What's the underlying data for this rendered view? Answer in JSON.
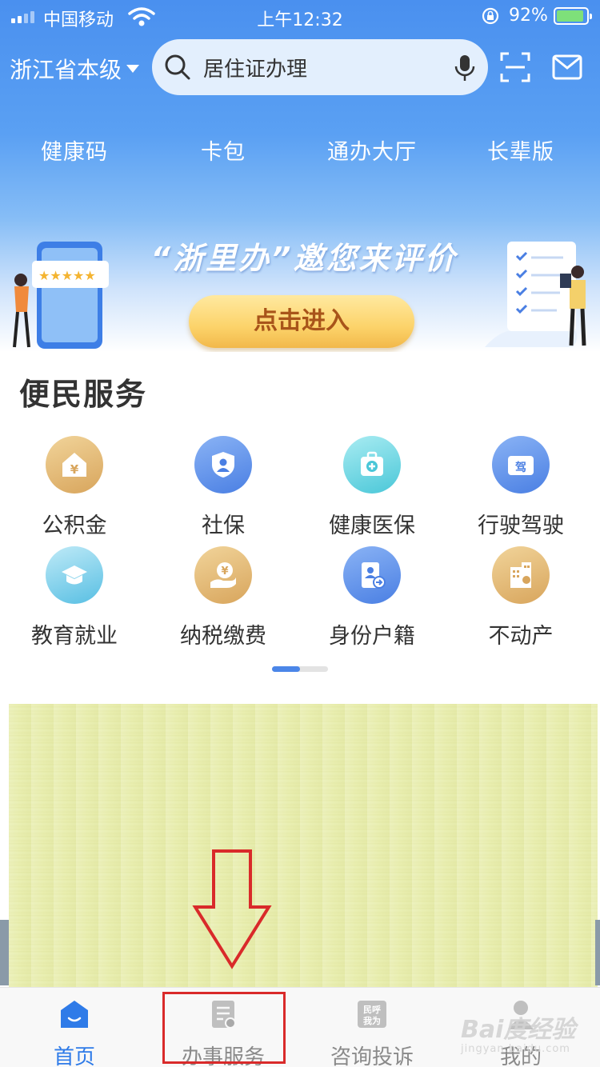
{
  "status": {
    "carrier": "中国移动",
    "time": "上午12:32",
    "battery_pct": "92%",
    "battery_level": 0.92
  },
  "header": {
    "region": "浙江省本级",
    "search_value": "居住证办理"
  },
  "quick_nav": [
    {
      "label": "健康码"
    },
    {
      "label": "卡包"
    },
    {
      "label": "通办大厅"
    },
    {
      "label": "长辈版"
    }
  ],
  "banner": {
    "title": "“浙里办”邀您来评价",
    "cta": "点击进入"
  },
  "services": {
    "title": "便民服务",
    "items": [
      {
        "label": "公积金",
        "icon": "house-yen-icon",
        "color": "#d8a55c"
      },
      {
        "label": "社保",
        "icon": "shield-user-icon",
        "color": "#4a7fe3"
      },
      {
        "label": "健康医保",
        "icon": "medical-kit-icon",
        "color": "#4ac7d8"
      },
      {
        "label": "行驶驾驶",
        "icon": "driver-card-icon",
        "color": "#4a7fe3"
      },
      {
        "label": "教育就业",
        "icon": "graduation-cap-icon",
        "color": "#58bfe3"
      },
      {
        "label": "纳税缴费",
        "icon": "tax-hand-yen-icon",
        "color": "#d8a55c"
      },
      {
        "label": "身份户籍",
        "icon": "id-badge-icon",
        "color": "#4a7fe3"
      },
      {
        "label": "不动产",
        "icon": "building-icon",
        "color": "#d8a55c"
      }
    ],
    "page_index": 1,
    "page_count": 2
  },
  "tabs": [
    {
      "label": "首页",
      "icon": "home-icon",
      "active": true
    },
    {
      "label": "办事服务",
      "icon": "document-service-icon",
      "active": false
    },
    {
      "label": "咨询投诉",
      "icon": "consult-complaint-icon",
      "active": false
    },
    {
      "label": "我的",
      "icon": "profile-icon",
      "active": false
    }
  ],
  "watermark": {
    "text": "Bai度经验",
    "sub": "jingyan.baidu.com"
  },
  "colors": {
    "brand_blue": "#4a90ef",
    "active_tab": "#2f7be8",
    "cta_text": "#a8541a",
    "annotation_red": "#d92a2a"
  }
}
